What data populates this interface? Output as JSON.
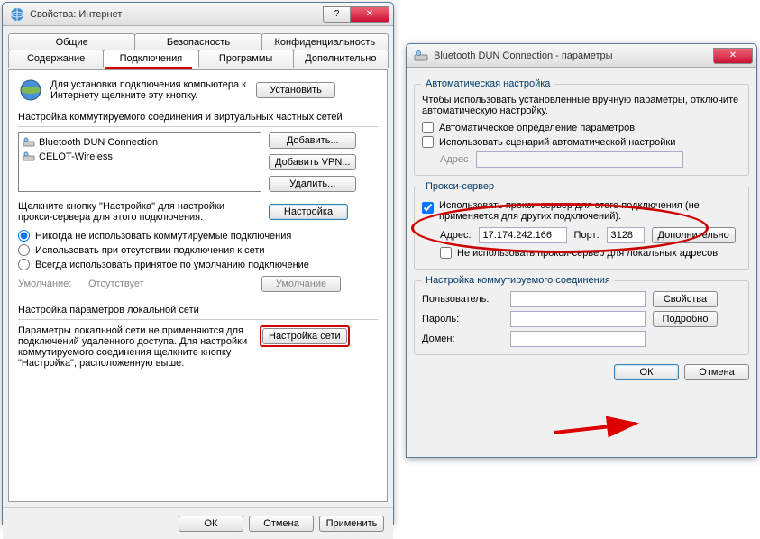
{
  "left": {
    "title": "Свойства: Интернет",
    "tabs_row1": [
      "Общие",
      "Безопасность",
      "Конфиденциальность"
    ],
    "tabs_row2": [
      "Содержание",
      "Подключения",
      "Программы",
      "Дополнительно"
    ],
    "active_tab": "Подключения",
    "install_text": "Для установки подключения компьютера к Интернету щелкните эту кнопку.",
    "install_btn": "Установить",
    "dial_section_label": "Настройка коммутируемого соединения и виртуальных частных сетей",
    "connections": [
      "Bluetooth DUN Connection",
      "CELOT-Wireless"
    ],
    "add_btn": "Добавить...",
    "add_vpn_btn": "Добавить VPN...",
    "remove_btn": "Удалить...",
    "settings_hint": "Щелкните кнопку \"Настройка\" для настройки прокси-сервера для этого подключения.",
    "settings_btn": "Настройка",
    "radio_never": "Никогда не использовать коммутируемые подключения",
    "radio_absent": "Использовать при отсутствии подключения к сети",
    "radio_always": "Всегда использовать принятое по умолчанию подключение",
    "default_label": "Умолчание:",
    "default_value": "Отсутствует",
    "default_btn": "Умолчание",
    "lan_section_label": "Настройка параметров локальной сети",
    "lan_hint": "Параметры локальной сети не применяются для подключений удаленного доступа. Для настройки коммутируемого соединения щелкните кнопку \"Настройка\", расположенную выше.",
    "lan_btn": "Настройка сети",
    "ok": "ОК",
    "cancel": "Отмена",
    "apply": "Применить"
  },
  "right": {
    "title": "Bluetooth DUN Connection - параметры",
    "auto_legend": "Автоматическая настройка",
    "auto_text": "Чтобы использовать установленные вручную параметры, отключите автоматическую настройку.",
    "auto_detect": "Автоматическое определение параметров",
    "use_script": "Использовать сценарий автоматической настройки",
    "address_label": "Адрес",
    "proxy_legend": "Прокси-сервер",
    "use_proxy": "Использовать прокси-сервер для этого подключения (не применяется для других подключений).",
    "addr_label": "Адрес:",
    "addr_value": "17.174.242.166",
    "port_label": "Порт:",
    "port_value": "3128",
    "advanced_btn": "Дополнительно",
    "bypass_local": "Не использовать прокси-сервер для локальных адресов",
    "dial_legend": "Настройка коммутируемого соединения",
    "user_label": "Пользователь:",
    "pass_label": "Пароль:",
    "domain_label": "Домен:",
    "props_btn": "Свойства",
    "more_btn": "Подробно",
    "ok": "ОК",
    "cancel": "Отмена"
  }
}
